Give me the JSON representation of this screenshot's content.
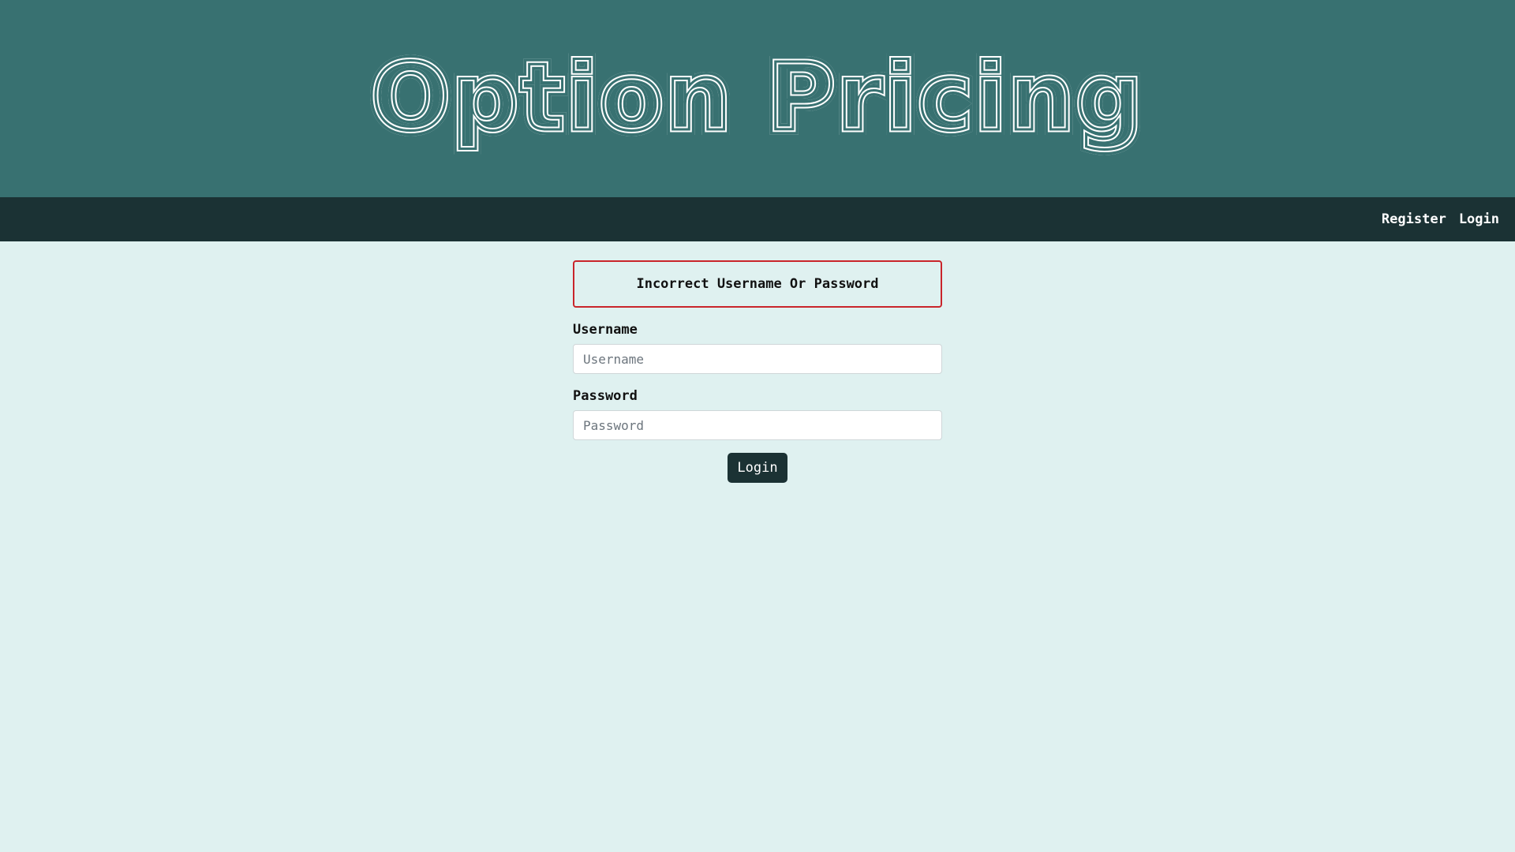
{
  "header": {
    "title": "Option Pricing",
    "background": "#387171"
  },
  "nav": {
    "background": "#1b3234",
    "register_label": "Register",
    "login_label": "Login"
  },
  "alert": {
    "message": "Incorrect Username Or Password",
    "border_color": "#c9252b"
  },
  "form": {
    "username_label": "Username",
    "username_placeholder": "Username",
    "username_value": "",
    "password_label": "Password",
    "password_placeholder": "Password",
    "password_value": "",
    "submit_label": "Login"
  },
  "page_background": "#dff1f0"
}
